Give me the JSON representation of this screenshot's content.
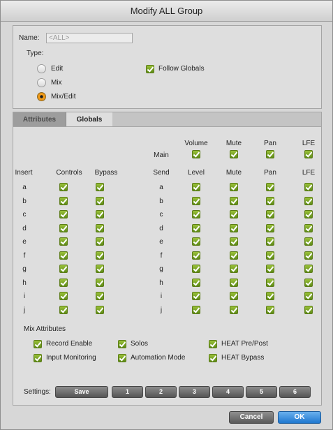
{
  "window": {
    "title": "Modify ALL Group"
  },
  "general": {
    "name_label": "Name:",
    "name_placeholder": "<ALL>",
    "type_label": "Type:",
    "types": [
      {
        "label": "Edit",
        "selected": false
      },
      {
        "label": "Mix",
        "selected": false
      },
      {
        "label": "Mix/Edit",
        "selected": true
      }
    ],
    "follow_globals": {
      "label": "Follow Globals",
      "checked": true
    }
  },
  "tabs": [
    {
      "label": "Attributes",
      "active": false
    },
    {
      "label": "Globals",
      "active": true
    }
  ],
  "globals": {
    "main_label": "Main",
    "main_headers": [
      "Volume",
      "Mute",
      "Pan",
      "LFE"
    ],
    "insert_header": "Insert",
    "insert_controls_header": "Controls",
    "insert_bypass_header": "Bypass",
    "send_header": "Send",
    "send_headers": [
      "Level",
      "Mute",
      "Pan",
      "LFE"
    ],
    "rows": [
      "a",
      "b",
      "c",
      "d",
      "e",
      "f",
      "g",
      "h",
      "i",
      "j"
    ]
  },
  "mix_attributes": {
    "title": "Mix Attributes",
    "items": [
      {
        "label": "Record Enable",
        "checked": true
      },
      {
        "label": "Solos",
        "checked": true
      },
      {
        "label": "HEAT Pre/Post",
        "checked": true
      },
      {
        "label": "Input Monitoring",
        "checked": true
      },
      {
        "label": "Automation Mode",
        "checked": true
      },
      {
        "label": "HEAT Bypass",
        "checked": true
      }
    ]
  },
  "settings": {
    "label": "Settings:",
    "save_label": "Save",
    "slots": [
      "1",
      "2",
      "3",
      "4",
      "5",
      "6"
    ]
  },
  "footer": {
    "cancel_label": "Cancel",
    "ok_label": "OK"
  },
  "colors": {
    "checkbox": "#6e9a1e",
    "radio_selected": "#f0a01a",
    "ok_button": "#2a85d8"
  }
}
